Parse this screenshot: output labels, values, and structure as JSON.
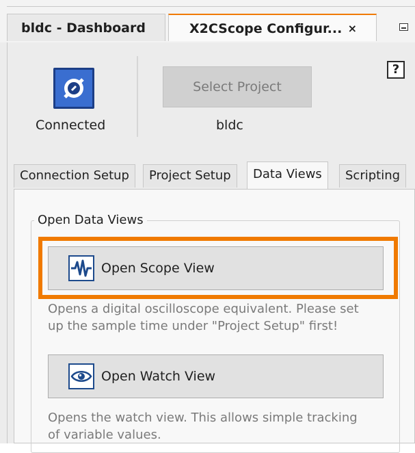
{
  "document_tabs": [
    {
      "label": "bldc - Dashboard",
      "active": false
    },
    {
      "label": "X2CScope Configur...",
      "active": true,
      "close_glyph": "×"
    }
  ],
  "connection": {
    "status_label": "Connected",
    "icon": "plug-icon"
  },
  "project": {
    "select_button_label": "Select Project",
    "name": "bldc"
  },
  "help": {
    "label": "?"
  },
  "inner_tabs": [
    {
      "label": "Connection Setup",
      "active": false
    },
    {
      "label": "Project Setup",
      "active": false
    },
    {
      "label": "Data Views",
      "active": true
    },
    {
      "label": "Scripting",
      "active": false
    }
  ],
  "data_views": {
    "group_title": "Open Data Views",
    "scope_button_label": "Open Scope View",
    "scope_description_line1": "Opens a digital oscilloscope equivalent. Please set",
    "scope_description_line2": "up the sample time under \"Project Setup\" first!",
    "watch_button_label": "Open Watch View",
    "watch_description_line1": "Opens the watch view. This allows simple tracking",
    "watch_description_line2": "of variable values."
  },
  "colors": {
    "accent": "#f07a00",
    "icon_blue": "#1d4a8c",
    "connected_blue": "#3a6ed0"
  }
}
